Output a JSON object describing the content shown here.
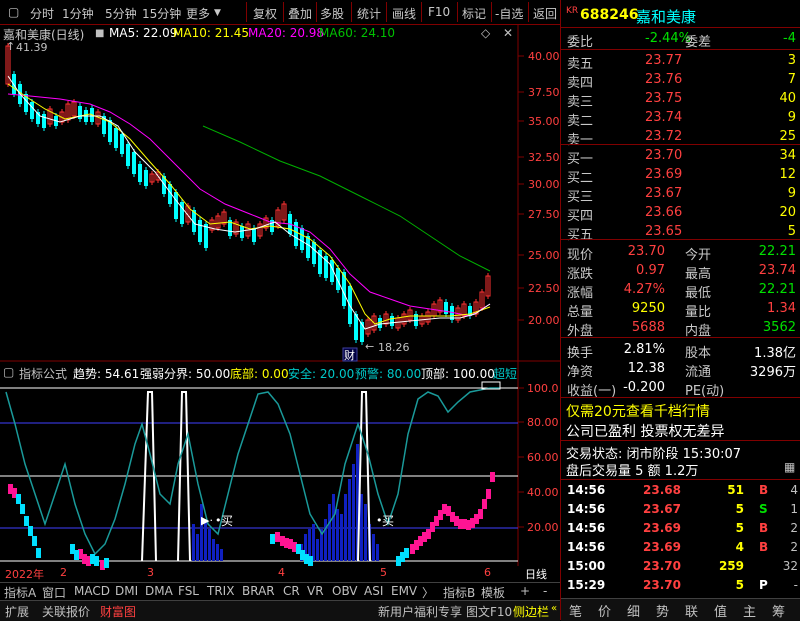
{
  "toolbar": {
    "items": [
      "分时",
      "1分钟",
      "5分钟",
      "15分钟",
      "更多",
      "复权",
      "叠加",
      "多股",
      "统计",
      "画线",
      "F10",
      "标记",
      "-自选",
      "返回"
    ]
  },
  "chart_header": {
    "name": "嘉和美康(日线)",
    "ma5": "MA5: 22.09",
    "ma10": "MA10: 21.45",
    "ma20": "MA20: 20.98",
    "ma60": "MA60: 24.10",
    "high_label": "41.39",
    "low_label": "18.26",
    "cai_label": "财"
  },
  "price_axis": [
    "40.00",
    "37.50",
    "35.00",
    "32.50",
    "30.00",
    "27.50",
    "25.00",
    "22.50",
    "20.00"
  ],
  "indicator_header": {
    "name": "指标公式",
    "trend": "趋势: 54.61",
    "divide": "强弱分界: 50.00",
    "bottom": "底部: 0.00",
    "safe": "安全: 20.00",
    "warn": "预警: 80.00",
    "top": "顶部: 100.00",
    "extra": "超短"
  },
  "indicator_axis": [
    "100.0",
    "80.00",
    "60.00",
    "40.00",
    "20.00"
  ],
  "indicator_labels": {
    "buy1": "买",
    "buy2": "买"
  },
  "time_axis": {
    "year": "2022年",
    "m2": "2",
    "m3": "3",
    "m4": "4",
    "m5": "5",
    "m6": "6",
    "period": "日线"
  },
  "tabs": [
    "指标A",
    "窗口",
    "MACD",
    "DMI",
    "DMA",
    "FSL",
    "TRIX",
    "BRAR",
    "CR",
    "VR",
    "OBV",
    "ASI",
    "EMV",
    "指标B",
    "模板",
    "+",
    "-"
  ],
  "status_bar": {
    "left": [
      "扩展",
      "关联报价",
      "财富图"
    ],
    "right": [
      "新用户福利专享",
      "图文F10",
      "侧边栏"
    ]
  },
  "quote": {
    "code": "688246",
    "name": "嘉和美康",
    "kr": "KR",
    "weibi_label": "委比",
    "weibi": "-2.44%",
    "weicha_label": "委差",
    "weicha": "-4",
    "sells": [
      {
        "label": "卖五",
        "price": "23.77",
        "vol": "3"
      },
      {
        "label": "卖四",
        "price": "23.76",
        "vol": "7"
      },
      {
        "label": "卖三",
        "price": "23.75",
        "vol": "40"
      },
      {
        "label": "卖二",
        "price": "23.74",
        "vol": "9"
      },
      {
        "label": "卖一",
        "price": "23.72",
        "vol": "25"
      }
    ],
    "buys": [
      {
        "label": "买一",
        "price": "23.70",
        "vol": "34"
      },
      {
        "label": "买二",
        "price": "23.69",
        "vol": "12"
      },
      {
        "label": "买三",
        "price": "23.67",
        "vol": "9"
      },
      {
        "label": "买四",
        "price": "23.66",
        "vol": "20"
      },
      {
        "label": "买五",
        "price": "23.65",
        "vol": "5"
      }
    ],
    "stats": [
      {
        "l1": "现价",
        "v1": "23.70",
        "l2": "今开",
        "v2": "22.21"
      },
      {
        "l1": "涨跌",
        "v1": "0.97",
        "l2": "最高",
        "v2": "23.74"
      },
      {
        "l1": "涨幅",
        "v1": "4.27%",
        "l2": "最低",
        "v2": "22.21"
      },
      {
        "l1": "总量",
        "v1": "9250",
        "l2": "量比",
        "v2": "1.34"
      },
      {
        "l1": "外盘",
        "v1": "5688",
        "l2": "内盘",
        "v2": "3562"
      }
    ],
    "stats2": [
      {
        "l1": "换手",
        "v1": "2.81%",
        "l2": "股本",
        "v2": "1.38亿"
      },
      {
        "l1": "净资",
        "v1": "12.38",
        "l2": "流通",
        "v2": "3296万"
      },
      {
        "l1": "收益(一)",
        "v1": "-0.200",
        "l2": "PE(动)",
        "v2": ""
      }
    ],
    "promo": "仅需20元查看千档行情",
    "profit": "公司已盈利 投票权无差异",
    "trade_state": "交易状态: 闭市阶段 15:30:07",
    "after_volume": "盘后交易量 5 额 1.2万",
    "ticks": [
      {
        "time": "14:56",
        "price": "23.68",
        "vol": "51",
        "bs": "B",
        "n": "4"
      },
      {
        "time": "14:56",
        "price": "23.67",
        "vol": "5",
        "bs": "S",
        "n": "1"
      },
      {
        "time": "14:56",
        "price": "23.69",
        "vol": "5",
        "bs": "B",
        "n": "2"
      },
      {
        "time": "14:56",
        "price": "23.69",
        "vol": "4",
        "bs": "B",
        "n": "2"
      },
      {
        "time": "15:00",
        "price": "23.70",
        "vol": "259",
        "bs": "",
        "n": "32"
      },
      {
        "time": "15:29",
        "price": "23.70",
        "vol": "5",
        "bs": "P",
        "n": "-"
      }
    ],
    "bottom_tabs": [
      "笔",
      "价",
      "细",
      "势",
      "联",
      "值",
      "主",
      "筹"
    ]
  },
  "colors": {
    "up": "#ff3232",
    "down": "#00ffff",
    "ma5": "#ffffff",
    "ma10": "#ffff00",
    "ma20": "#ff00ff",
    "ma60": "#00c000"
  }
}
